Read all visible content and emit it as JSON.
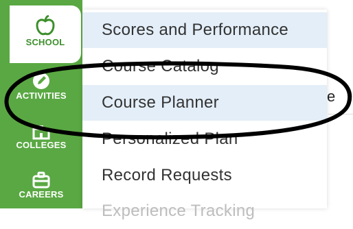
{
  "sidebar": {
    "items": [
      {
        "label": "SCHOOL",
        "icon": "apple-icon",
        "active": true
      },
      {
        "label": "ACTIVITIES",
        "icon": "pencil-icon",
        "active": false
      },
      {
        "label": "COLLEGES",
        "icon": "building-icon",
        "active": false
      },
      {
        "label": "CAREERS",
        "icon": "briefcase-icon",
        "active": false
      }
    ],
    "color": "#5aa843"
  },
  "menu": {
    "items": [
      {
        "label": "Scores and Performance"
      },
      {
        "label": "Course Catalog"
      },
      {
        "label": "Course Planner"
      },
      {
        "label": "Personalized Plan"
      },
      {
        "label": "Record Requests"
      },
      {
        "label": "Experience Tracking"
      }
    ],
    "highlight_color": "#e3eef8"
  },
  "background": {
    "partial_text": "e"
  },
  "annotation": {
    "shape": "ellipse",
    "color": "#000000",
    "target": "Course Planner"
  }
}
